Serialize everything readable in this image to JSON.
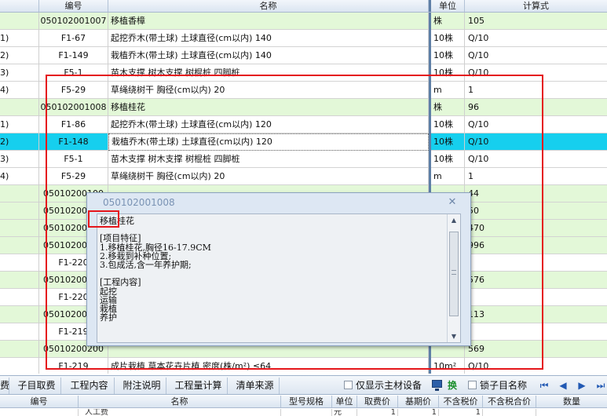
{
  "grid": {
    "headers": {
      "code": "编号",
      "name": "名称",
      "unit": "单位",
      "calc": "计算式"
    },
    "rows": [
      {
        "idx": "",
        "code": "050102001007",
        "name": "移植香樟",
        "unit": "株",
        "calc": "105",
        "type": "cat"
      },
      {
        "idx": "1)",
        "code": "F1-67",
        "name": "起挖乔木(带土球) 土球直径(cm以内) 140",
        "unit": "10株",
        "calc": "Q/10",
        "type": "item"
      },
      {
        "idx": "2)",
        "code": "F1-149",
        "name": "栽植乔木(带土球) 土球直径(cm以内) 140",
        "unit": "10株",
        "calc": "Q/10",
        "type": "item"
      },
      {
        "idx": "3)",
        "code": "F5-1",
        "name": "苗木支撑 树木支撑 树棍桩 四脚桩",
        "unit": "10株",
        "calc": "Q/10",
        "type": "item"
      },
      {
        "idx": "4)",
        "code": "F5-29",
        "name": "草绳绕树干 胸径(cm以内) 20",
        "unit": "m",
        "calc": "1",
        "type": "item"
      },
      {
        "idx": "",
        "code": "050102001008",
        "name": "移植桂花",
        "unit": "株",
        "calc": "96",
        "type": "cat"
      },
      {
        "idx": "1)",
        "code": "F1-86",
        "name": "起挖乔木(带土球) 土球直径(cm以内) 120",
        "unit": "10株",
        "calc": "Q/10",
        "type": "item"
      },
      {
        "idx": "2)",
        "code": "F1-148",
        "name": "栽植乔木(带土球) 土球直径(cm以内) 120",
        "unit": "10株",
        "calc": "Q/10",
        "type": "sel"
      },
      {
        "idx": "3)",
        "code": "F5-1",
        "name": "苗木支撑 树木支撑 树棍桩 四脚桩",
        "unit": "10株",
        "calc": "Q/10",
        "type": "item"
      },
      {
        "idx": "4)",
        "code": "F5-29",
        "name": "草绳绕树干 胸径(cm以内) 20",
        "unit": "m",
        "calc": "1",
        "type": "item"
      },
      {
        "idx": "",
        "code": "05010200100",
        "name": "",
        "unit": "",
        "calc": "44",
        "type": "cat"
      },
      {
        "idx": "",
        "code": "05010200100",
        "name": "",
        "unit": "",
        "calc": "50",
        "type": "cat"
      },
      {
        "idx": "",
        "code": "05010200100",
        "name": "",
        "unit": "",
        "calc": "470",
        "type": "cat"
      },
      {
        "idx": "",
        "code": "05010200200",
        "name": "",
        "unit": "",
        "calc": "996",
        "type": "cat"
      },
      {
        "idx": "",
        "code": "F1-220",
        "name": "",
        "unit": "",
        "calc": "",
        "type": "item"
      },
      {
        "idx": "",
        "code": "05010200200",
        "name": "",
        "unit": "",
        "calc": "576",
        "type": "cat"
      },
      {
        "idx": "",
        "code": "F1-220",
        "name": "",
        "unit": "",
        "calc": "",
        "type": "item"
      },
      {
        "idx": "",
        "code": "05010200200",
        "name": "",
        "unit": "",
        "calc": "113",
        "type": "cat"
      },
      {
        "idx": "",
        "code": "F1-219",
        "name": "",
        "unit": "",
        "calc": "",
        "type": "item"
      },
      {
        "idx": "",
        "code": "05010200200",
        "name": "",
        "unit": "",
        "calc": "569",
        "type": "cat"
      },
      {
        "idx": "",
        "code": "F1-219",
        "name": "成片栽植 草本花卉片植 密度(株/m²) ≤64",
        "unit": "10m²",
        "calc": "Q/10",
        "type": "item"
      }
    ]
  },
  "popup": {
    "title": "050102001008",
    "close": "✕",
    "text": "移植桂花\n\n[项目特征]\n1.移植桂花,胸径16-17.9CM\n2.移栽到补种位置;\n3.包成活,含一年养护期;\n\n[工程内容]\n起挖\n运输\n栽植\n养护"
  },
  "toolbar": {
    "tabs": [
      "费",
      "子目取费",
      "工程内容",
      "附注说明",
      "工程量计算",
      "清单来源"
    ],
    "show_main_material": "仅显示主材设备",
    "swap": "换",
    "lock_name": "锁子目名称",
    "nav": [
      "⏮",
      "◀",
      "▶",
      "⏭"
    ]
  },
  "bottom_grid": {
    "headers": [
      "编号",
      "名称",
      "型号规格",
      "单位",
      "取费价",
      "基期价",
      "不含税价",
      "不含税合价",
      "数量"
    ],
    "row": [
      "",
      "人工费",
      "",
      "元",
      "1",
      "1",
      "1",
      "",
      ""
    ]
  },
  "colors": {
    "category_row": "#e3f8d8",
    "selected_row": "#16cfee",
    "highlight": "#e5161b"
  }
}
